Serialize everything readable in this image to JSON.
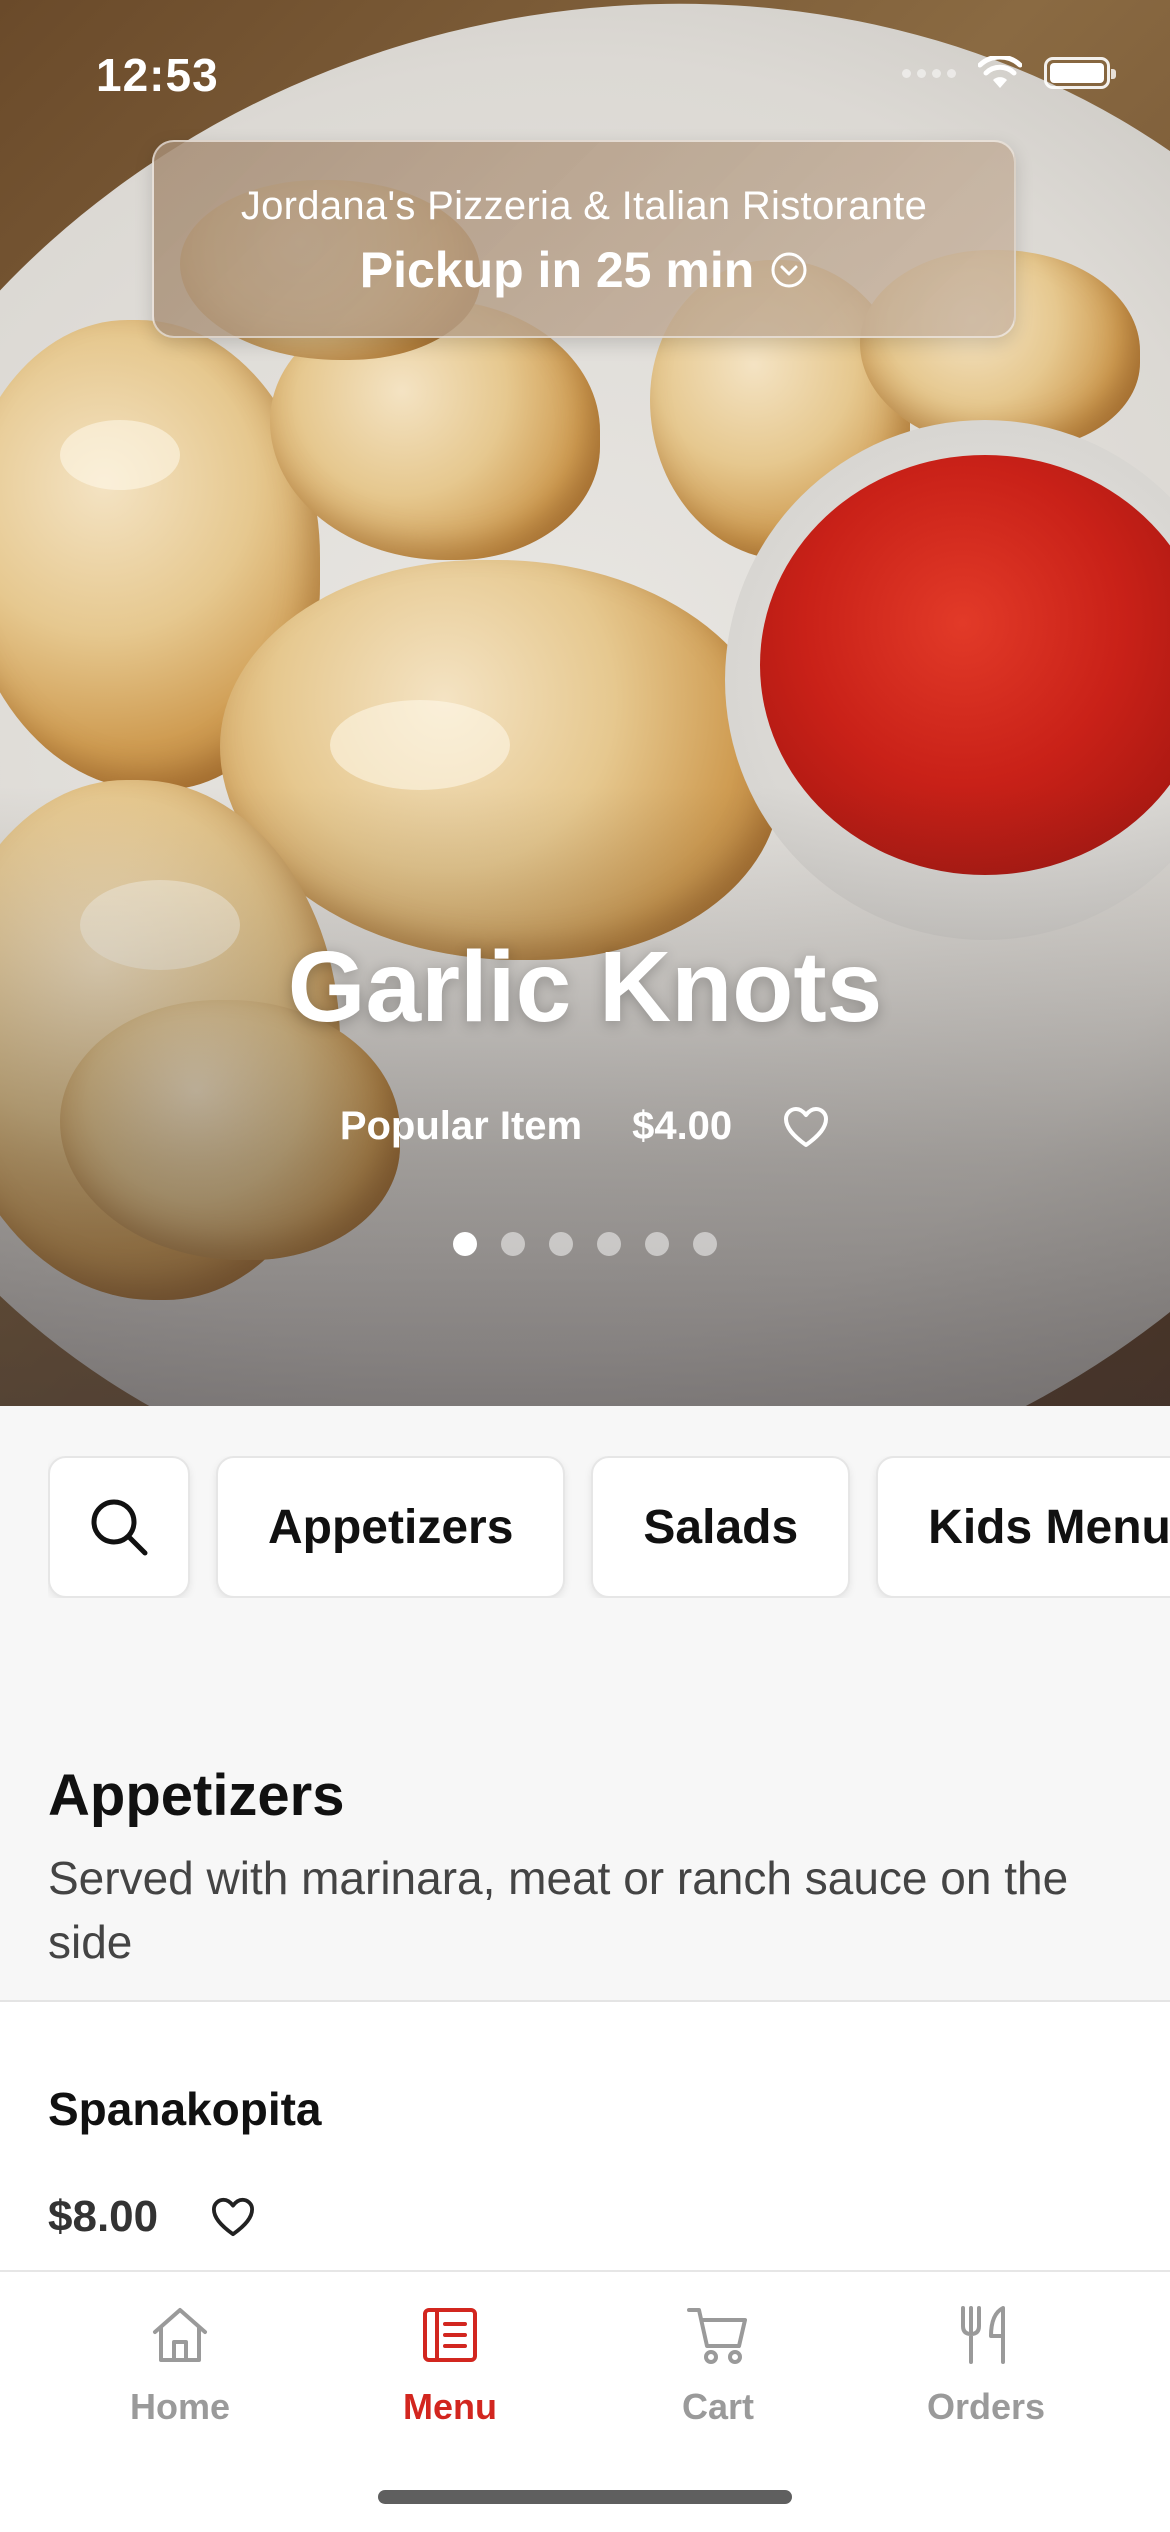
{
  "status_bar": {
    "time": "12:53"
  },
  "header": {
    "restaurant_name": "Jordana's Pizzeria & Italian Ristorante",
    "pickup_label": "Pickup in 25 min"
  },
  "featured": {
    "title": "Garlic Knots",
    "badge": "Popular Item",
    "price": "$4.00",
    "page_count": 6,
    "active_page": 1
  },
  "categories": {
    "search_icon": "search-icon",
    "items": [
      {
        "label": "Appetizers"
      },
      {
        "label": "Salads"
      },
      {
        "label": "Kids Menu"
      }
    ]
  },
  "section": {
    "title": "Appetizers",
    "description": "Served with marinara, meat or ranch sauce on the side"
  },
  "menu_items": [
    {
      "name": "Spanakopita",
      "price": "$8.00"
    }
  ],
  "tabbar": {
    "tabs": [
      {
        "label": "Home",
        "icon": "home-icon"
      },
      {
        "label": "Menu",
        "icon": "menu-icon",
        "active": true
      },
      {
        "label": "Cart",
        "icon": "cart-icon"
      },
      {
        "label": "Orders",
        "icon": "orders-icon"
      }
    ]
  },
  "colors": {
    "accent": "#d2261f",
    "inactive": "#9a9a9a"
  }
}
